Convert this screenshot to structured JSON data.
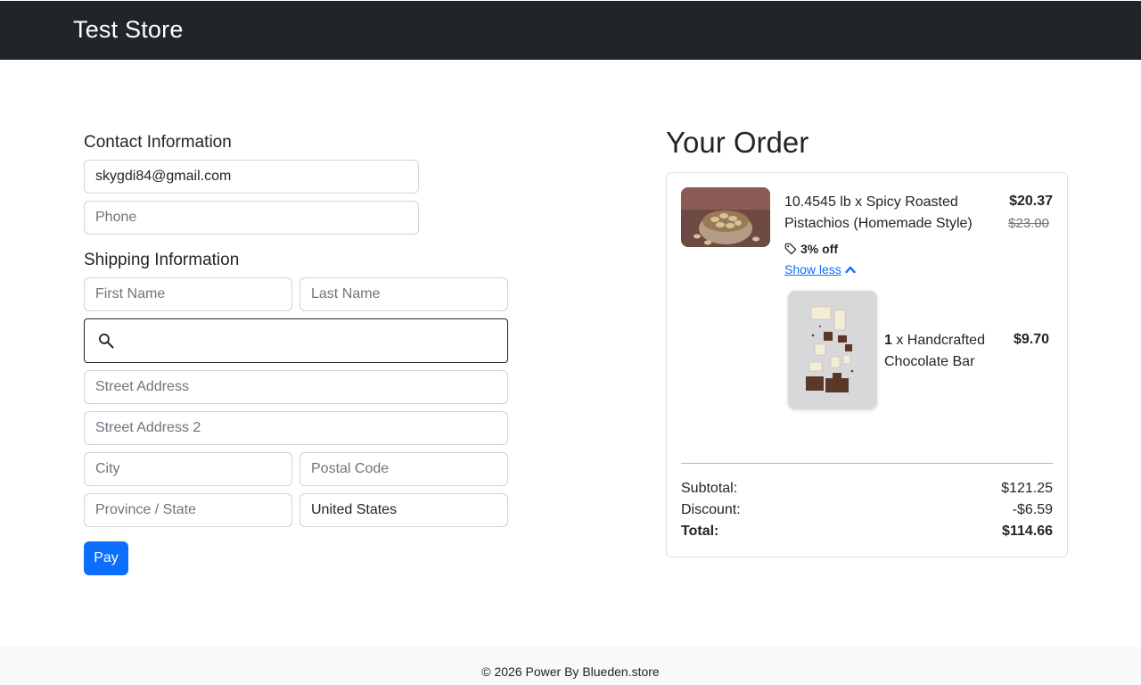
{
  "header": {
    "brand": "Test Store"
  },
  "contact": {
    "title": "Contact Information",
    "email_value": "skygdi84@gmail.com",
    "phone_placeholder": "Phone"
  },
  "shipping": {
    "title": "Shipping Information",
    "first_name_placeholder": "First Name",
    "last_name_placeholder": "Last Name",
    "search_value": "",
    "street_placeholder": "Street Address",
    "street2_placeholder": "Street Address 2",
    "city_placeholder": "City",
    "postal_placeholder": "Postal Code",
    "province_placeholder": "Province / State",
    "country_value": "United States"
  },
  "pay_button": "Pay",
  "order": {
    "title": "Your Order",
    "items": [
      {
        "name_line1": "10.4545 lb x Spicy Roasted",
        "name_line2": "Pistachios (Homemade Style)",
        "price": "$20.37",
        "original_price": "$23.00",
        "discount": "3% off",
        "toggle": "Show less"
      }
    ],
    "sub_items": [
      {
        "qty": "1",
        "name_line1": " x Handcrafted",
        "name_line2": "Chocolate Bar",
        "price": "$9.70"
      }
    ],
    "summary": {
      "subtotal_label": "Subtotal:",
      "subtotal_value": "$121.25",
      "discount_label": "Discount:",
      "discount_value": "-$6.59",
      "total_label": "Total:",
      "total_value": "$114.66"
    }
  },
  "footer": {
    "text": "© 2026 Power By Blueden.store"
  }
}
